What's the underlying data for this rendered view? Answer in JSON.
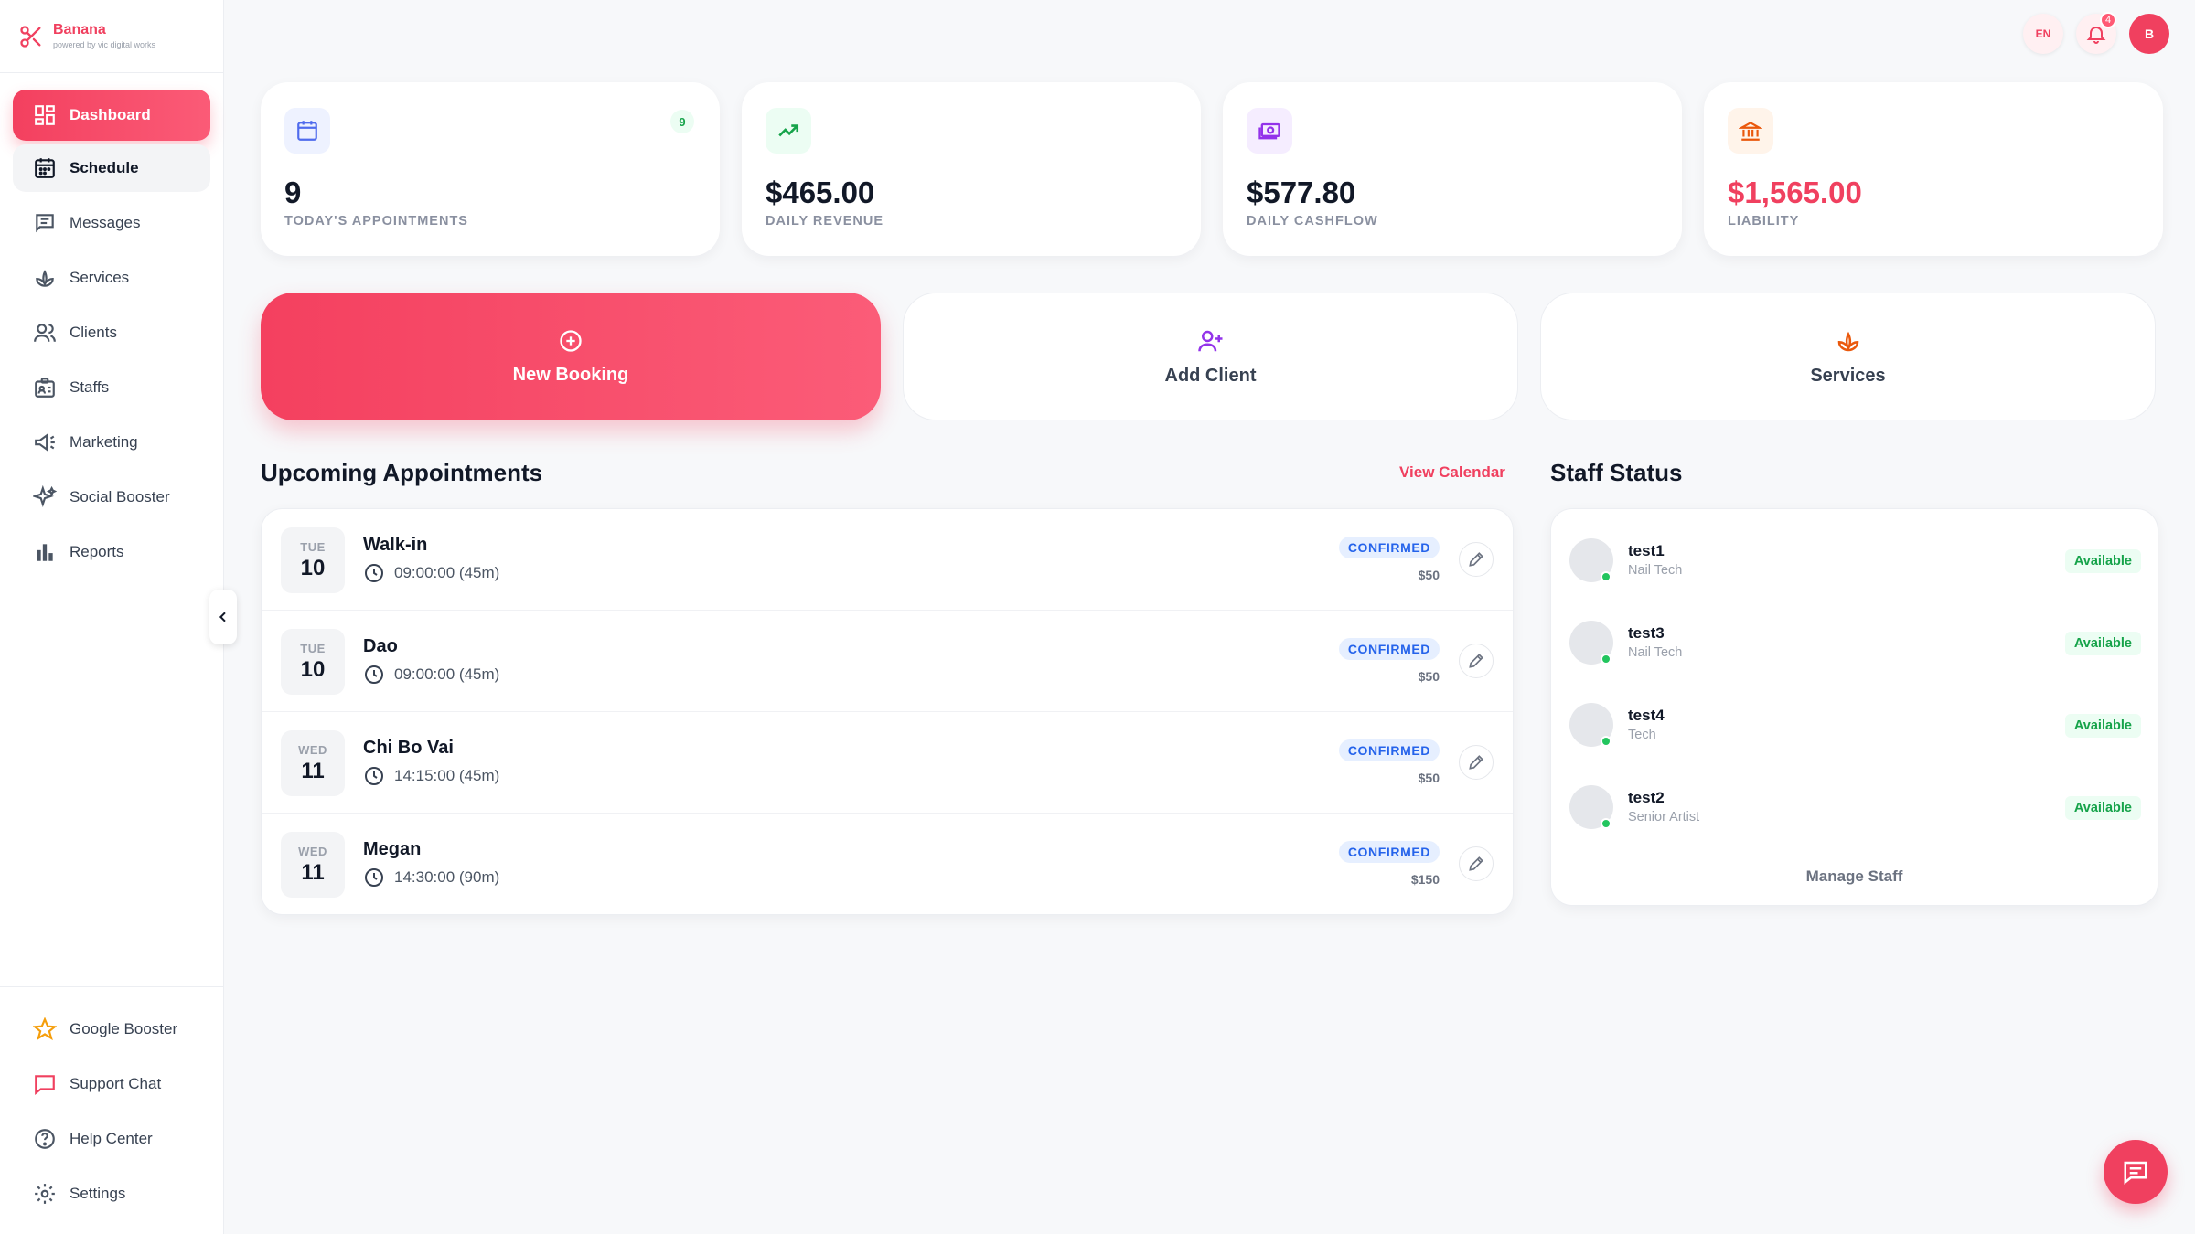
{
  "brand": {
    "name": "Banana",
    "tagline": "powered by vic digital works"
  },
  "sidebar": {
    "items": [
      {
        "label": "Dashboard",
        "icon": "dashboard-icon",
        "active": true
      },
      {
        "label": "Schedule",
        "icon": "calendar-icon"
      },
      {
        "label": "Messages",
        "icon": "message-icon"
      },
      {
        "label": "Services",
        "icon": "lotus-icon"
      },
      {
        "label": "Clients",
        "icon": "users-icon"
      },
      {
        "label": "Staffs",
        "icon": "staff-badge-icon"
      },
      {
        "label": "Marketing",
        "icon": "megaphone-icon"
      },
      {
        "label": "Social Booster",
        "icon": "sparkles-icon"
      },
      {
        "label": "Reports",
        "icon": "bar-chart-icon"
      }
    ],
    "bottom_items": [
      {
        "label": "Google Booster",
        "icon": "star-icon"
      },
      {
        "label": "Support Chat",
        "icon": "chat-icon"
      },
      {
        "label": "Help Center",
        "icon": "help-icon"
      },
      {
        "label": "Settings",
        "icon": "gear-icon"
      }
    ]
  },
  "topbar": {
    "language": "EN",
    "notifications_count": "4",
    "avatar_initial": "B"
  },
  "stats": [
    {
      "value": "9",
      "label": "TODAY'S APPOINTMENTS",
      "badge": "9",
      "icon": "calendar-icon",
      "color": "#4f6bed"
    },
    {
      "value": "$465.00",
      "label": "DAILY REVENUE",
      "icon": "trending-up-icon",
      "color": "#16a34a"
    },
    {
      "value": "$577.80",
      "label": "DAILY CASHFLOW",
      "icon": "cash-icon",
      "color": "#9333ea"
    },
    {
      "value": "$1,565.00",
      "label": "LIABILITY",
      "icon": "bank-icon",
      "color": "#f0405f"
    }
  ],
  "actions": [
    {
      "label": "New Booking",
      "icon": "plus-circle-icon"
    },
    {
      "label": "Add Client",
      "icon": "user-plus-icon"
    },
    {
      "label": "Services",
      "icon": "lotus-icon"
    }
  ],
  "upcoming": {
    "title": "Upcoming Appointments",
    "view_calendar": "View Calendar",
    "rows": [
      {
        "dow": "TUE",
        "day": "10",
        "name": "Walk-in",
        "time": "09:00:00 (45m)",
        "status": "CONFIRMED",
        "price": "$50"
      },
      {
        "dow": "TUE",
        "day": "10",
        "name": "Dao",
        "time": "09:00:00 (45m)",
        "status": "CONFIRMED",
        "price": "$50"
      },
      {
        "dow": "WED",
        "day": "11",
        "name": "Chi Bo Vai",
        "time": "14:15:00 (45m)",
        "status": "CONFIRMED",
        "price": "$50"
      },
      {
        "dow": "WED",
        "day": "11",
        "name": "Megan",
        "time": "14:30:00 (90m)",
        "status": "CONFIRMED",
        "price": "$150"
      }
    ]
  },
  "staff": {
    "title": "Staff Status",
    "manage_label": "Manage Staff",
    "members": [
      {
        "name": "test1",
        "role": "Nail Tech",
        "status": "Available"
      },
      {
        "name": "test3",
        "role": "Nail Tech",
        "status": "Available"
      },
      {
        "name": "test4",
        "role": "Tech",
        "status": "Available"
      },
      {
        "name": "test2",
        "role": "Senior Artist",
        "status": "Available"
      }
    ]
  },
  "colors": {
    "accent": "#f0405f",
    "confirmed": "#2563eb",
    "available": "#16a34a"
  }
}
